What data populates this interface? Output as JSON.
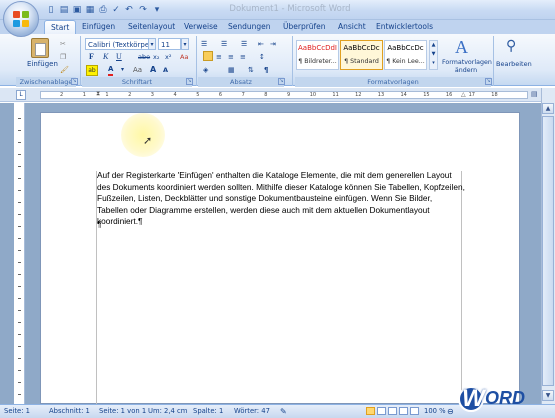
{
  "window": {
    "title": "Dokument1 - Microsoft Word"
  },
  "tabs": [
    "Start",
    "Einfügen",
    "Seitenlayout",
    "Verweise",
    "Sendungen",
    "Überprüfen",
    "Ansicht",
    "Entwicklertools"
  ],
  "clipboard": {
    "paste_label": "Einfügen",
    "group_label": "Zwischenablage"
  },
  "font": {
    "family": "Calibri (Textkörper)",
    "size": "11",
    "bold": "F",
    "italic": "K",
    "underline": "U",
    "strike": "abe",
    "subscript": "x₂",
    "superscript": "x²",
    "clear": "Aa",
    "grow": "A",
    "shrink": "A",
    "font_color": "A",
    "group_label": "Schriftart"
  },
  "paragraph": {
    "group_label": "Absatz",
    "pilcrow": "¶"
  },
  "styles": {
    "items": [
      {
        "sample": "AaBbCcDdI",
        "name": "¶ Bildreter..."
      },
      {
        "sample": "AaBbCcDc",
        "name": "¶ Standard"
      },
      {
        "sample": "AaBbCcDc",
        "name": "¶ Kein Lee..."
      }
    ],
    "change_label": "Formatvorlagen ändern",
    "group_label": "Formatvorlagen"
  },
  "editing": {
    "label": "Bearbeiten"
  },
  "ruler": {
    "labels": [
      "2",
      "1",
      "1",
      "2",
      "3",
      "4",
      "5",
      "6",
      "7",
      "8",
      "9",
      "10",
      "11",
      "12",
      "13",
      "14",
      "15",
      "16",
      "17",
      "18"
    ]
  },
  "document": {
    "paragraph": "Auf der Registerkarte 'Einfügen' enthalten die Kataloge Elemente, die mit dem generellen Layout des Dokuments koordiniert werden sollten. Mithilfe dieser Kataloge können Sie Tabellen, Kopfzeilen, Fußzeilen, Listen, Deckblätter und sonstige Dokumentbausteine einfügen. Wenn Sie Bilder, Tabellen oder Diagramme erstellen, werden diese auch mit dem aktuellen Dokumentlayout koordiniert.¶",
    "empty_mark": "¶"
  },
  "status": {
    "page": "Seite: 1",
    "section": "Abschnitt: 1",
    "page_of": "Seite: 1 von 1",
    "position": "Um: 2,4 cm",
    "column": "Spalte: 1",
    "words": "Wörter: 47",
    "zoom": "100 %"
  },
  "logo": {
    "text": "WORD"
  },
  "colors": {
    "ribbon": "#dfeaf8",
    "accent": "#15428b",
    "doc_background": "#8fa9c8"
  }
}
